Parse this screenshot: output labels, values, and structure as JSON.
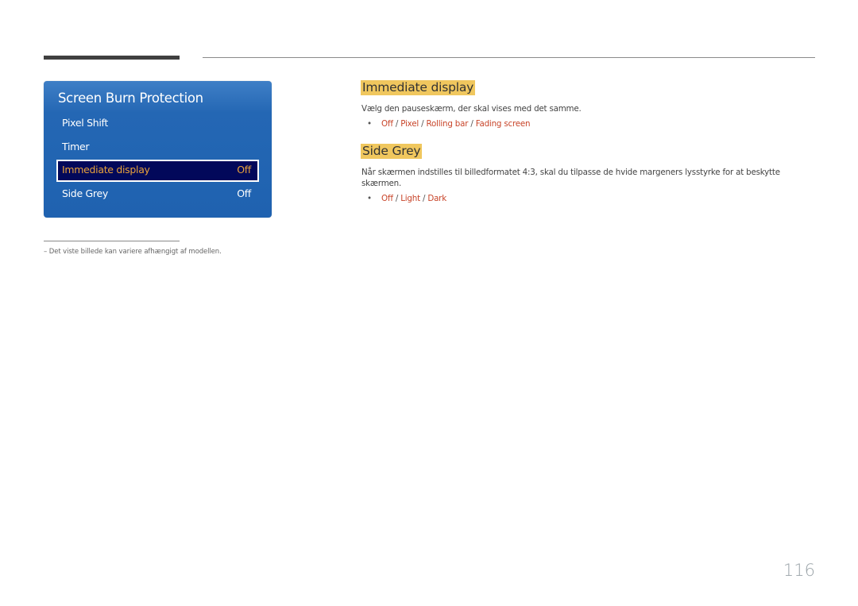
{
  "panel": {
    "title": "Screen Burn Protection",
    "items": [
      {
        "label": "Pixel Shift",
        "value": ""
      },
      {
        "label": "Timer",
        "value": ""
      },
      {
        "label": "Immediate display",
        "value": "Off",
        "selected": true
      },
      {
        "label": "Side Grey",
        "value": "Off"
      }
    ]
  },
  "sections": [
    {
      "heading": "Immediate display",
      "text": "Vælg den pauseskærm, der skal vises med det samme.",
      "bullet": "•",
      "options": [
        "Off",
        "Pixel",
        "Rolling bar",
        "Fading screen"
      ],
      "separator": "/"
    },
    {
      "heading": "Side Grey",
      "text": "Når skærmen indstilles til billedformatet 4:3, skal du tilpasse de hvide margeners lysstyrke for at beskytte skærmen.",
      "bullet": "•",
      "options": [
        "Off",
        "Light",
        "Dark"
      ],
      "separator": "/"
    }
  ],
  "footnote": "–  Det viste billede kan variere afhængigt af modellen.",
  "page_number": "116",
  "colors": {
    "panel_blue": "#2467b4",
    "selected_bg": "#02085a",
    "selected_text": "#e9a23b",
    "heading_highlight": "#f0c75e",
    "option_red": "#c8452a"
  }
}
